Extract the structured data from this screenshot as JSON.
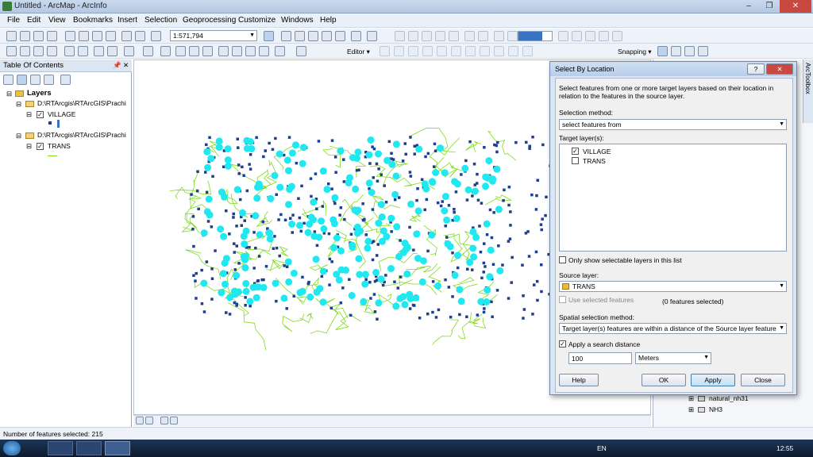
{
  "window": {
    "title": "Untitled - ArcMap - ArcInfo",
    "minimize": "–",
    "maximize": "❐",
    "close": "✕"
  },
  "menu": [
    "File",
    "Edit",
    "View",
    "Bookmarks",
    "Insert",
    "Selection",
    "Geoprocessing",
    "Customize",
    "Windows",
    "Help"
  ],
  "toolbar": {
    "scale": "1:571,794",
    "editor_label": "Editor ▾",
    "snapping_label": "Snapping ▾"
  },
  "toc": {
    "title": "Table Of Contents",
    "pin": "📌",
    "close": "✕",
    "root": "Layers",
    "groups": [
      {
        "path": "D:\\RTArcgis\\RTArcGIS\\Prachi",
        "layer": "VILLAGE"
      },
      {
        "path": "D:\\RTArcgis\\RTArcGIS\\Prachi",
        "layer": "TRANS"
      }
    ]
  },
  "dialog": {
    "title": "Select By Location",
    "help_glyph": "?",
    "close_glyph": "✕",
    "description": "Select features from one or more target layers based on their location in relation to the features in the source layer.",
    "selection_method_label": "Selection method:",
    "selection_method_value": "select features from",
    "target_layers_label": "Target layer(s):",
    "target_layers": [
      {
        "name": "VILLAGE",
        "checked": true
      },
      {
        "name": "TRANS",
        "checked": false
      }
    ],
    "only_selectable_label": "Only show selectable layers in this list",
    "source_layer_label": "Source layer:",
    "source_layer_value": "TRANS",
    "use_selected_label": "Use selected features",
    "features_selected_note": "(0 features selected)",
    "spatial_method_label": "Spatial selection method:",
    "spatial_method_value": "Target layer(s) features are within a distance of the Source layer feature",
    "apply_search_label": "Apply a search distance",
    "distance_value": "100",
    "distance_unit": "Meters",
    "buttons": {
      "help": "Help",
      "ok": "OK",
      "apply": "Apply",
      "close": "Close"
    }
  },
  "side_panel": {
    "toolbox_label": "ArcToolbox",
    "items": [
      "natural_nh31",
      "NH3"
    ]
  },
  "status": "Number of features selected: 215",
  "taskbar": {
    "lang": "EN",
    "time": "12:55"
  },
  "colors": {
    "village_dot": "#1f3f8c",
    "selected_dot": "#20e8f0",
    "road": "#7fdc1e",
    "accent": "#3b73c4"
  }
}
